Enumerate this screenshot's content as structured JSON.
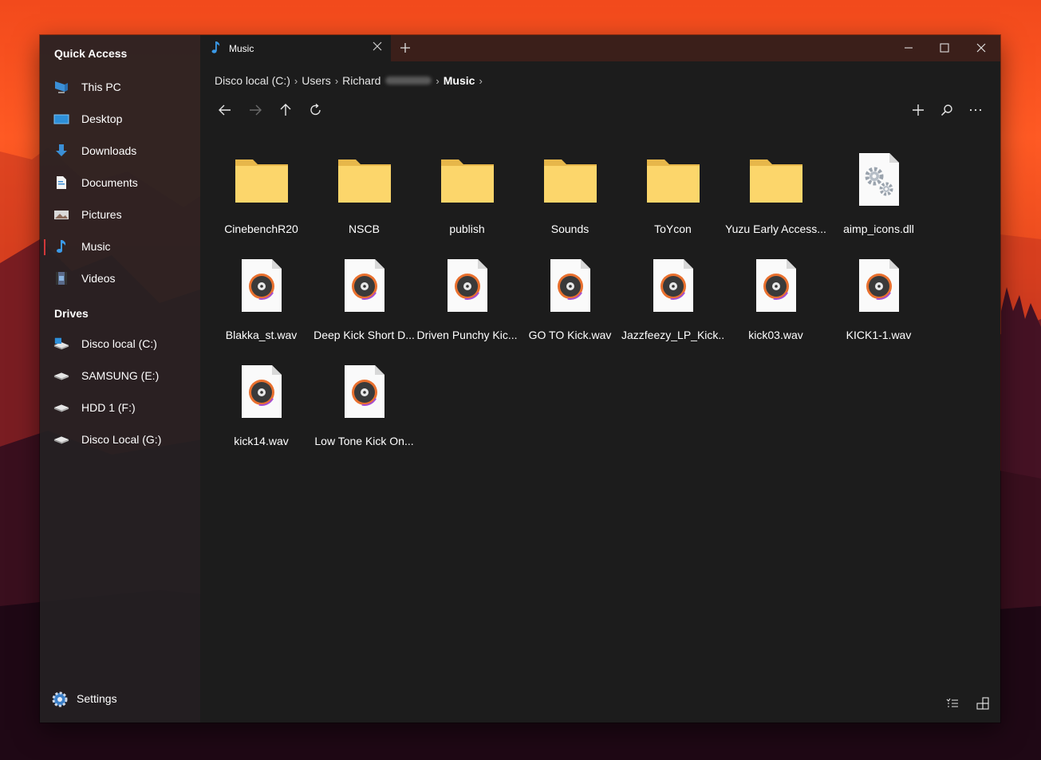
{
  "window": {
    "tab_title": "Music",
    "accent": "#d1383a",
    "folder_color": "#fcd66b"
  },
  "sidebar": {
    "quick_access_title": "Quick Access",
    "quick_access": [
      {
        "label": "This PC",
        "icon": "this-pc-icon"
      },
      {
        "label": "Desktop",
        "icon": "desktop-icon"
      },
      {
        "label": "Downloads",
        "icon": "downloads-icon"
      },
      {
        "label": "Documents",
        "icon": "documents-icon"
      },
      {
        "label": "Pictures",
        "icon": "pictures-icon"
      },
      {
        "label": "Music",
        "icon": "music-icon",
        "active": true
      },
      {
        "label": "Videos",
        "icon": "videos-icon"
      }
    ],
    "drives_title": "Drives",
    "drives": [
      {
        "label": "Disco local (C:)",
        "icon": "system-drive-icon"
      },
      {
        "label": "SAMSUNG (E:)",
        "icon": "drive-icon"
      },
      {
        "label": "HDD 1 (F:)",
        "icon": "drive-icon"
      },
      {
        "label": "Disco Local (G:)",
        "icon": "drive-icon"
      }
    ],
    "settings_label": "Settings"
  },
  "breadcrumb": {
    "items": [
      "Disco local (C:)",
      "Users",
      "Richard",
      "Music"
    ]
  },
  "files": [
    {
      "name": "CinebenchR20",
      "type": "folder"
    },
    {
      "name": "NSCB",
      "type": "folder"
    },
    {
      "name": "publish",
      "type": "folder"
    },
    {
      "name": "Sounds",
      "type": "folder"
    },
    {
      "name": "ToYcon",
      "type": "folder"
    },
    {
      "name": "Yuzu Early Access...",
      "type": "folder"
    },
    {
      "name": "aimp_icons.dll",
      "type": "dll"
    },
    {
      "name": "Blakka_st.wav",
      "type": "audio"
    },
    {
      "name": "Deep Kick Short D...",
      "type": "audio"
    },
    {
      "name": "Driven Punchy Kic...",
      "type": "audio"
    },
    {
      "name": "GO TO Kick.wav",
      "type": "audio"
    },
    {
      "name": "Jazzfeezy_LP_Kick...",
      "type": "audio"
    },
    {
      "name": "kick03.wav",
      "type": "audio"
    },
    {
      "name": "KICK1-1.wav",
      "type": "audio"
    },
    {
      "name": "kick14.wav",
      "type": "audio"
    },
    {
      "name": "Low Tone Kick On...",
      "type": "audio"
    }
  ]
}
